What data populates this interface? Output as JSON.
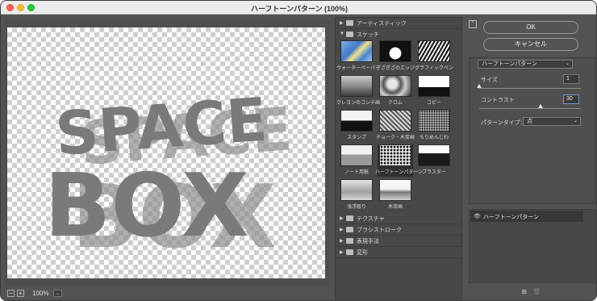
{
  "window": {
    "title": "ハーフトーンパターン (100%)"
  },
  "preview": {
    "artwork_lines": [
      "SPACE",
      "BOX"
    ]
  },
  "zoom": {
    "out_label": "−",
    "in_label": "+",
    "value": "100%",
    "dropdown": "⌄"
  },
  "gallery": {
    "categories_top": [
      {
        "label": "アーティスティック",
        "arrow": "▶"
      },
      {
        "label": "スケッチ",
        "arrow": "▼"
      }
    ],
    "filters": [
      {
        "label": "ウォーターペーパー",
        "style": "water"
      },
      {
        "label": "ぎざぎざのエッジ",
        "style": "torn"
      },
      {
        "label": "グラフィックペン",
        "style": "pen"
      },
      {
        "label": "クレヨンのコンテ画",
        "style": "conte"
      },
      {
        "label": "クロム",
        "style": "chrome"
      },
      {
        "label": "コピー",
        "style": "copy"
      },
      {
        "label": "スタンプ",
        "style": "stamp"
      },
      {
        "label": "チョーク・木炭画",
        "style": "chalk"
      },
      {
        "label": "ちりめんじわ",
        "style": "reticulation"
      },
      {
        "label": "ノート用紙",
        "style": "note"
      },
      {
        "label": "ハーフトーンパターン",
        "style": "halftone",
        "selected": true
      },
      {
        "label": "プラスター",
        "style": "plaster"
      },
      {
        "label": "浅浮彫り",
        "style": "basrelief"
      },
      {
        "label": "木炭画",
        "style": "charcoal"
      }
    ],
    "categories_bottom": [
      {
        "label": "テクスチャ",
        "arrow": "▶"
      },
      {
        "label": "ブラシストローク",
        "arrow": "▶"
      },
      {
        "label": "表現手法",
        "arrow": "▶"
      },
      {
        "label": "変形",
        "arrow": "▶"
      }
    ]
  },
  "buttons": {
    "ok": "OK",
    "cancel": "キャンセル",
    "collapse": "⌃"
  },
  "settings": {
    "filter_select": "ハーフトーンパターン",
    "size_label": "サイズ",
    "size_value": "1",
    "size_level": 0.0,
    "contrast_label": "コントラスト",
    "contrast_value": "30",
    "contrast_level": 0.6,
    "pattern_label": "パターンタイプ：",
    "pattern_value": "点"
  },
  "layers": {
    "items": [
      {
        "name": "ハーフトーンパターン"
      }
    ],
    "new_icon": "⊞",
    "delete_icon": "🗑"
  },
  "colors": {
    "panel": "#535353",
    "accent_focus": "#6a9bd8",
    "artwork": "#7a7a7a"
  }
}
